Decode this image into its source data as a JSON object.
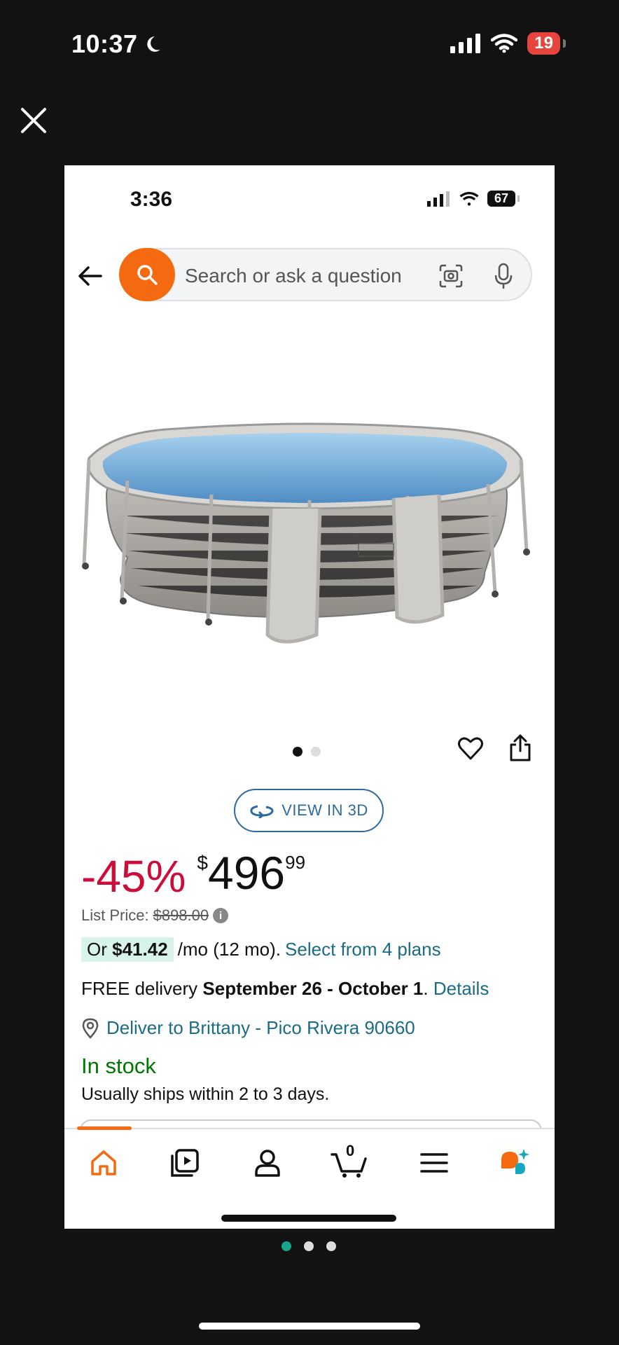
{
  "outer_status": {
    "time": "10:37",
    "battery": "19"
  },
  "inner_status": {
    "time": "3:36",
    "battery": "67"
  },
  "search": {
    "placeholder": "Search or ask a question"
  },
  "image_carousel": {
    "count": 2,
    "active": 0
  },
  "view3d_label": "VIEW IN 3D",
  "price": {
    "discount": "-45%",
    "currency": "$",
    "whole": "496",
    "fraction": "99",
    "list_label": "List Price:",
    "list_value": "$898.00"
  },
  "monthly": {
    "prefix": "Or",
    "amount": "$41.42",
    "suffix": "/mo (12 mo).",
    "link": "Select from 4 plans"
  },
  "delivery": {
    "free": "FREE delivery",
    "dates": "September 26 - October 1",
    "period": ".",
    "link": "Details"
  },
  "deliver_to": "Deliver to Brittany - Pico Rivera 90660",
  "stock": "In stock",
  "ships": "Usually ships within 2 to 3 days.",
  "cart_count": "0",
  "tabs": [
    "home",
    "video",
    "account",
    "cart",
    "menu",
    "rufus"
  ],
  "outer_pager": {
    "count": 3,
    "active": 0
  },
  "colors": {
    "accent": "#f56a10",
    "discount": "#cc0c39",
    "link": "#1b6b86",
    "stock": "#007600",
    "pager": "#19a58a"
  }
}
